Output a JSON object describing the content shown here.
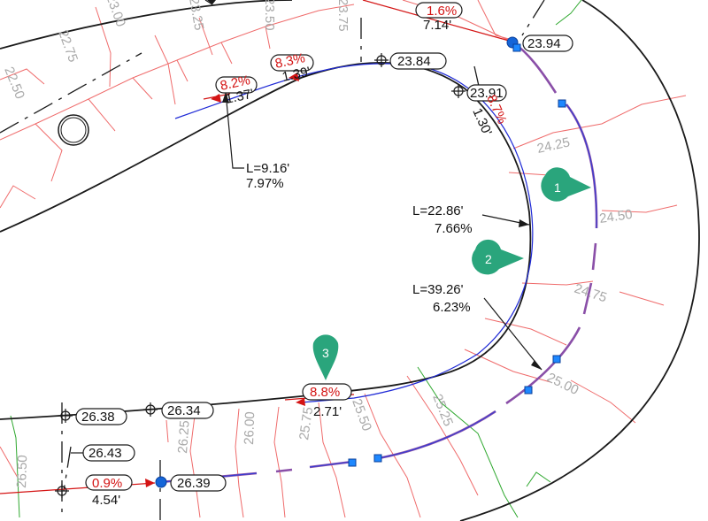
{
  "drawing": {
    "colors": {
      "background": "#ffffff",
      "edge_line": "#1a1a1a",
      "contour": "#ef6b6b",
      "contour_label": "#a9a9a9",
      "slope_text": "#d41414",
      "flowline": "#1f2ad6",
      "profile_line": "#8a4fa8",
      "node": "#1565d8",
      "marker": "#2aa57c",
      "green_line": "#2fa82f"
    },
    "spot_elevations": [
      "23.94",
      "23.84",
      "23.91",
      "26.38",
      "26.34",
      "26.43",
      "26.39"
    ],
    "contour_labels": [
      "22.50",
      "22.75",
      "23.00",
      "23.25",
      "23.50",
      "23.75",
      "24.25",
      "24.50",
      "24.75",
      "25.00",
      "25.25",
      "25.50",
      "25.75",
      "26.00",
      "26.25",
      "26.50"
    ],
    "slope_labels": [
      "1.6%",
      "8.2%",
      "8.3%",
      "8.7%",
      "8.8%",
      "0.9%"
    ],
    "distance_labels": [
      "7.14'",
      "1.37'",
      "1.39'",
      "1.30'",
      "2.71'",
      "4.54'"
    ],
    "callouts": [
      {
        "length": "L=9.16'",
        "grade": "7.97%"
      },
      {
        "length": "L=22.86'",
        "grade": "7.66%"
      },
      {
        "length": "L=39.26'",
        "grade": "6.23%"
      }
    ],
    "markers": [
      "1",
      "2",
      "3"
    ]
  }
}
